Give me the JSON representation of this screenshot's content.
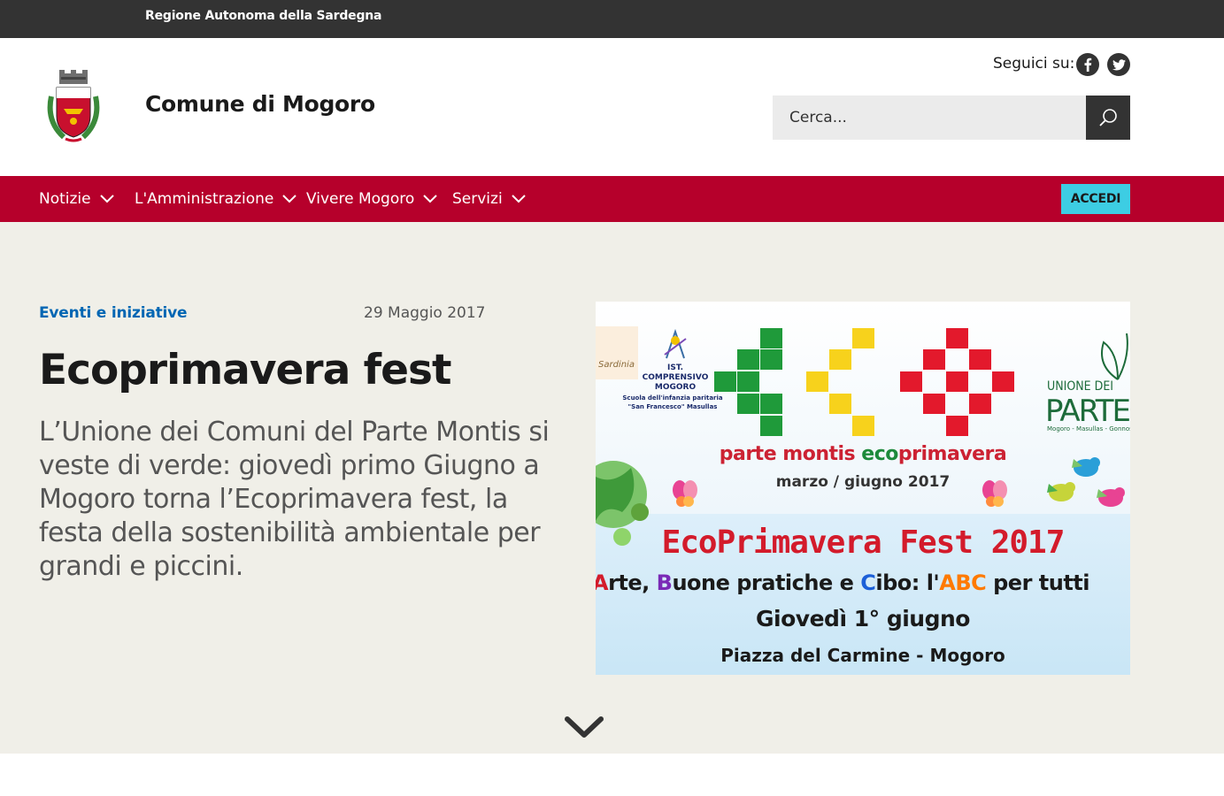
{
  "topbar": {
    "region_link": "Regione Autonoma della Sardegna"
  },
  "header": {
    "site_title": "Comune di Mogoro",
    "social_label": "Seguici su:",
    "search": {
      "placeholder": "Cerca..."
    }
  },
  "nav": {
    "items": [
      {
        "label": "Notizie"
      },
      {
        "label": "L'Amministrazione"
      },
      {
        "label": "Vivere Mogoro"
      },
      {
        "label": "Servizi"
      }
    ],
    "login_label": "ACCEDI"
  },
  "hero": {
    "category": "Eventi e iniziative",
    "date": "29 Maggio 2017",
    "title": "Ecoprimavera fest",
    "lead": "L’Unione dei Comuni del Parte Montis si veste di verde: giovedì primo Giugno a Mogoro torna l’Ecoprimavera fest, la festa della sostenibilità ambientale per grandi e piccini.",
    "poster": {
      "school_title": "IST. COMPRENSIVO MOGORO",
      "school_sub": "Scuola dell'infanzia paritaria \"San Francesco\" Masullas",
      "sardinia": "Sardinia",
      "unione": "UNIONE DEI",
      "parte": "PARTE M",
      "towns": "Mogoro - Masullas - Gonnostramatza",
      "line1_a": "parte montis ",
      "line1_b": "eco",
      "line1_c": "primavera",
      "line2": "marzo / giugno 2017",
      "fest": "EcoPrimavera Fest 2017",
      "abc_a": "A",
      "abc_1": "rte, ",
      "abc_b": "B",
      "abc_2": "uone pratiche e ",
      "abc_c": "C",
      "abc_3": "ibo: l'",
      "abc_abc": "ABC",
      "abc_4": " per tutti",
      "day": "Giovedì 1° giugno",
      "place": "Piazza del Carmine - Mogoro"
    }
  },
  "colors": {
    "topbar": "#333333",
    "nav": "#b6002b",
    "login": "#3dcde3",
    "hero_bg": "#f0efe8",
    "category": "#0066b3"
  },
  "icons": [
    "coat-of-arms-logo",
    "facebook-icon",
    "twitter-icon",
    "search-icon",
    "chevron-down-icon",
    "scroll-down-icon"
  ]
}
